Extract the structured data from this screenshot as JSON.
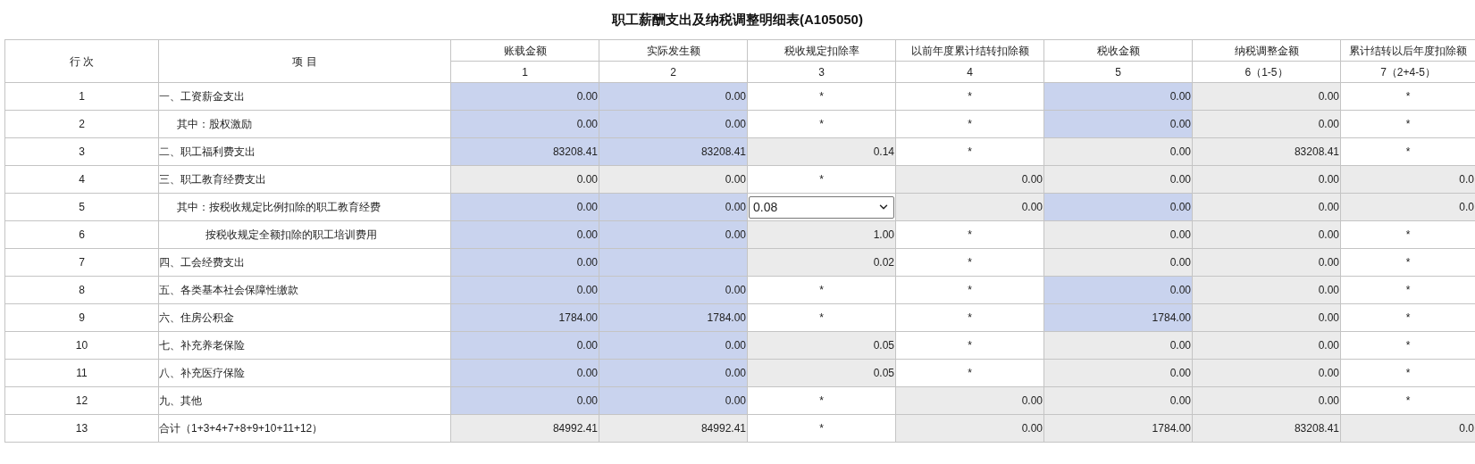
{
  "title": "职工薪酬支出及纳税调整明细表(A105050)",
  "table": {
    "columns": [
      {
        "label": "行 次"
      },
      {
        "label": "项 目"
      },
      {
        "label": "账载金额",
        "number": "1"
      },
      {
        "label": "实际发生额",
        "number": "2"
      },
      {
        "label": "税收规定扣除率",
        "number": "3"
      },
      {
        "label": "以前年度累计结转扣除额",
        "number": "4"
      },
      {
        "label": "税收金额",
        "number": "5"
      },
      {
        "label": "纳税调整金额",
        "number": "6（1-5）"
      },
      {
        "label": "累计结转以后年度扣除额",
        "number": "7（2+4-5）"
      }
    ],
    "rows": [
      {
        "cells": [
          {
            "kind": "line",
            "text": "1"
          },
          {
            "kind": "item",
            "text": "一、工资薪金支出"
          },
          {
            "kind": "input",
            "text": "0.00"
          },
          {
            "kind": "input",
            "text": "0.00"
          },
          {
            "kind": "fixed",
            "text": "*"
          },
          {
            "kind": "fixed",
            "text": "*"
          },
          {
            "kind": "input",
            "text": "0.00"
          },
          {
            "kind": "calc",
            "text": "0.00"
          },
          {
            "kind": "fixed",
            "text": "*"
          }
        ]
      },
      {
        "cells": [
          {
            "kind": "line",
            "text": "2"
          },
          {
            "kind": "subitem",
            "text": "其中：股权激励"
          },
          {
            "kind": "input",
            "text": "0.00"
          },
          {
            "kind": "input",
            "text": "0.00"
          },
          {
            "kind": "fixed",
            "text": "*"
          },
          {
            "kind": "fixed",
            "text": "*"
          },
          {
            "kind": "input",
            "text": "0.00"
          },
          {
            "kind": "calc",
            "text": "0.00"
          },
          {
            "kind": "fixed",
            "text": "*"
          }
        ]
      },
      {
        "cells": [
          {
            "kind": "line",
            "text": "3"
          },
          {
            "kind": "item",
            "text": "二、职工福利费支出"
          },
          {
            "kind": "input",
            "text": "83208.41"
          },
          {
            "kind": "input",
            "text": "83208.41"
          },
          {
            "kind": "calc",
            "text": "0.14"
          },
          {
            "kind": "fixed",
            "text": "*"
          },
          {
            "kind": "calc",
            "text": "0.00"
          },
          {
            "kind": "calc",
            "text": "83208.41"
          },
          {
            "kind": "fixed",
            "text": "*"
          }
        ]
      },
      {
        "cells": [
          {
            "kind": "line",
            "text": "4"
          },
          {
            "kind": "item",
            "text": "三、职工教育经费支出"
          },
          {
            "kind": "calc",
            "text": "0.00"
          },
          {
            "kind": "calc",
            "text": "0.00"
          },
          {
            "kind": "fixed",
            "text": "*"
          },
          {
            "kind": "calc",
            "text": "0.00"
          },
          {
            "kind": "calc",
            "text": "0.00"
          },
          {
            "kind": "calc",
            "text": "0.00"
          },
          {
            "kind": "calc",
            "text": "0.0"
          }
        ]
      },
      {
        "cells": [
          {
            "kind": "line",
            "text": "5"
          },
          {
            "kind": "subitem",
            "text": "其中：按税收规定比例扣除的职工教育经费"
          },
          {
            "kind": "input",
            "text": "0.00"
          },
          {
            "kind": "input",
            "text": "0.00"
          },
          {
            "kind": "select",
            "text": "0.08"
          },
          {
            "kind": "calc",
            "text": "0.00"
          },
          {
            "kind": "input",
            "text": "0.00"
          },
          {
            "kind": "calc",
            "text": "0.00"
          },
          {
            "kind": "calc",
            "text": "0.0"
          }
        ]
      },
      {
        "cells": [
          {
            "kind": "line",
            "text": "6"
          },
          {
            "kind": "subitem2",
            "text": "按税收规定全额扣除的职工培训费用"
          },
          {
            "kind": "input",
            "text": "0.00"
          },
          {
            "kind": "input",
            "text": "0.00"
          },
          {
            "kind": "calc",
            "text": "1.00"
          },
          {
            "kind": "fixed",
            "text": "*"
          },
          {
            "kind": "calc",
            "text": "0.00"
          },
          {
            "kind": "calc",
            "text": "0.00"
          },
          {
            "kind": "fixed",
            "text": "*"
          }
        ]
      },
      {
        "cells": [
          {
            "kind": "line",
            "text": "7"
          },
          {
            "kind": "item",
            "text": "四、工会经费支出"
          },
          {
            "kind": "input",
            "text": "0.00"
          },
          {
            "kind": "input"
          },
          {
            "kind": "calc",
            "text": "0.02"
          },
          {
            "kind": "fixed",
            "text": "*"
          },
          {
            "kind": "calc",
            "text": "0.00"
          },
          {
            "kind": "calc",
            "text": "0.00"
          },
          {
            "kind": "fixed",
            "text": "*"
          }
        ]
      },
      {
        "cells": [
          {
            "kind": "line",
            "text": "8"
          },
          {
            "kind": "item",
            "text": "五、各类基本社会保障性缴款"
          },
          {
            "kind": "input",
            "text": "0.00"
          },
          {
            "kind": "input",
            "text": "0.00"
          },
          {
            "kind": "fixed",
            "text": "*"
          },
          {
            "kind": "fixed",
            "text": "*"
          },
          {
            "kind": "input",
            "text": "0.00"
          },
          {
            "kind": "calc",
            "text": "0.00"
          },
          {
            "kind": "fixed",
            "text": "*"
          }
        ]
      },
      {
        "cells": [
          {
            "kind": "line",
            "text": "9"
          },
          {
            "kind": "item",
            "text": "六、住房公积金"
          },
          {
            "kind": "input",
            "text": "1784.00"
          },
          {
            "kind": "input",
            "text": "1784.00"
          },
          {
            "kind": "fixed",
            "text": "*"
          },
          {
            "kind": "fixed",
            "text": "*"
          },
          {
            "kind": "input",
            "text": "1784.00"
          },
          {
            "kind": "calc",
            "text": "0.00"
          },
          {
            "kind": "fixed",
            "text": "*"
          }
        ]
      },
      {
        "cells": [
          {
            "kind": "line",
            "text": "10"
          },
          {
            "kind": "item",
            "text": "七、补充养老保险"
          },
          {
            "kind": "input",
            "text": "0.00"
          },
          {
            "kind": "input",
            "text": "0.00"
          },
          {
            "kind": "calc",
            "text": "0.05"
          },
          {
            "kind": "fixed",
            "text": "*"
          },
          {
            "kind": "calc",
            "text": "0.00"
          },
          {
            "kind": "calc",
            "text": "0.00"
          },
          {
            "kind": "fixed",
            "text": "*"
          }
        ]
      },
      {
        "cells": [
          {
            "kind": "line",
            "text": "11"
          },
          {
            "kind": "item",
            "text": "八、补充医疗保险"
          },
          {
            "kind": "input",
            "text": "0.00"
          },
          {
            "kind": "input",
            "text": "0.00"
          },
          {
            "kind": "calc",
            "text": "0.05"
          },
          {
            "kind": "fixed",
            "text": "*"
          },
          {
            "kind": "calc",
            "text": "0.00"
          },
          {
            "kind": "calc",
            "text": "0.00"
          },
          {
            "kind": "fixed",
            "text": "*"
          }
        ]
      },
      {
        "cells": [
          {
            "kind": "line",
            "text": "12"
          },
          {
            "kind": "item",
            "text": "九、其他"
          },
          {
            "kind": "input",
            "text": "0.00"
          },
          {
            "kind": "input",
            "text": "0.00"
          },
          {
            "kind": "fixed",
            "text": "*"
          },
          {
            "kind": "calc",
            "text": "0.00"
          },
          {
            "kind": "calc",
            "text": "0.00"
          },
          {
            "kind": "calc",
            "text": "0.00"
          },
          {
            "kind": "fixed",
            "text": "*"
          }
        ]
      },
      {
        "cells": [
          {
            "kind": "line",
            "text": "13"
          },
          {
            "kind": "item",
            "text": "合计（1+3+4+7+8+9+10+11+12）"
          },
          {
            "kind": "calc",
            "text": "84992.41"
          },
          {
            "kind": "calc",
            "text": "84992.41"
          },
          {
            "kind": "fixed",
            "text": "*"
          },
          {
            "kind": "calc",
            "text": "0.00"
          },
          {
            "kind": "calc",
            "text": "1784.00"
          },
          {
            "kind": "calc",
            "text": "83208.41"
          },
          {
            "kind": "calc",
            "text": "0.0"
          }
        ]
      }
    ]
  }
}
